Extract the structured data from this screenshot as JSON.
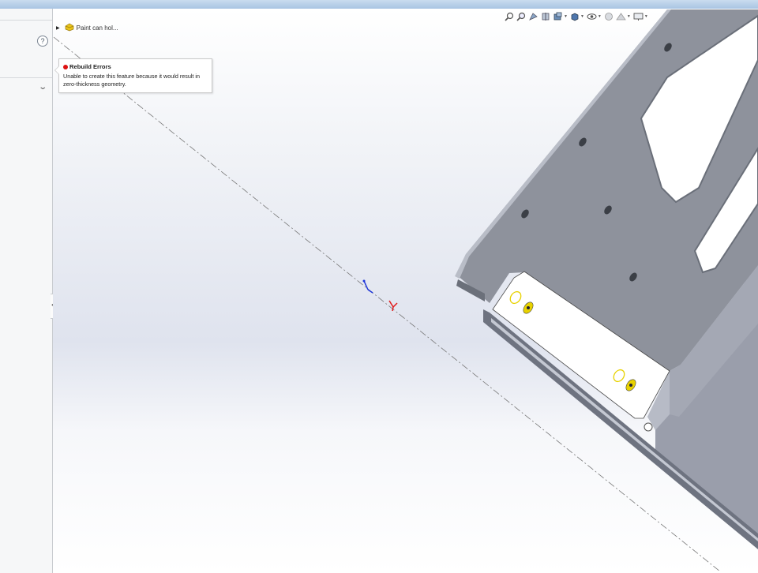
{
  "feature_tree": {
    "item_label": "Paint can hol..."
  },
  "error_tooltip": {
    "title": "Rebuild Errors",
    "message": "Unable to create this feature because it would result in zero-thickness geometry."
  },
  "left_panel": {
    "help_glyph": "?"
  },
  "heads_up_toolbar": {
    "tools": [
      "zoom-to-fit-icon",
      "zoom-to-area-icon",
      "previous-view-icon",
      "section-view-icon",
      "view-orientation-icon",
      "display-style-icon",
      "hide-show-items-icon",
      "edit-appearance-icon",
      "apply-scene-icon",
      "view-settings-icon"
    ]
  },
  "colors": {
    "part_face": "#8e929c",
    "part_edge": "#6a6f79",
    "error_red": "#dd1111",
    "selection_yellow": "#e8d200"
  }
}
